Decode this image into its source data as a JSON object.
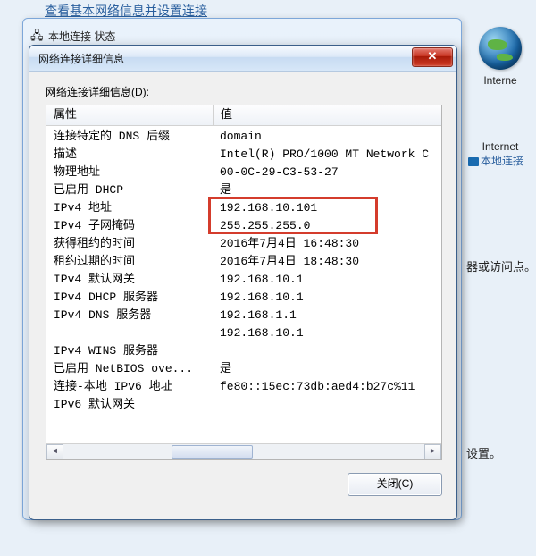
{
  "bg_link": "查看基本网络信息并设置连接",
  "outer_window": {
    "title": "本地连接 状态"
  },
  "inner_window": {
    "title": "网络连接详细信息",
    "group_label": "网络连接详细信息(D):",
    "header_prop": "属性",
    "header_val": "值",
    "rows": [
      {
        "prop": "连接特定的 DNS 后缀",
        "val": "domain"
      },
      {
        "prop": "描述",
        "val": "Intel(R) PRO/1000 MT Network C"
      },
      {
        "prop": "物理地址",
        "val": "00-0C-29-C3-53-27"
      },
      {
        "prop": "已启用 DHCP",
        "val": "是"
      },
      {
        "prop": "IPv4 地址",
        "val": "192.168.10.101"
      },
      {
        "prop": "IPv4 子网掩码",
        "val": "255.255.255.0"
      },
      {
        "prop": "获得租约的时间",
        "val": "2016年7月4日 16:48:30"
      },
      {
        "prop": "租约过期的时间",
        "val": "2016年7月4日 18:48:30"
      },
      {
        "prop": "IPv4 默认网关",
        "val": "192.168.10.1"
      },
      {
        "prop": "IPv4 DHCP 服务器",
        "val": "192.168.10.1"
      },
      {
        "prop": "IPv4 DNS 服务器",
        "val": "192.168.1.1"
      },
      {
        "prop": "",
        "val": "192.168.10.1"
      },
      {
        "prop": "IPv4 WINS 服务器",
        "val": ""
      },
      {
        "prop": "已启用 NetBIOS ove...",
        "val": "是"
      },
      {
        "prop": "连接-本地 IPv6 地址",
        "val": "fe80::15ec:73db:aed4:b27c%11"
      },
      {
        "prop": "IPv6 默认网关",
        "val": ""
      }
    ],
    "close_btn_label": "关闭(C)"
  },
  "right_panel": {
    "label1": "Interne",
    "label2": "Internet",
    "link": "本地连接",
    "text1": "器或访问点。",
    "text2": "设置。"
  }
}
